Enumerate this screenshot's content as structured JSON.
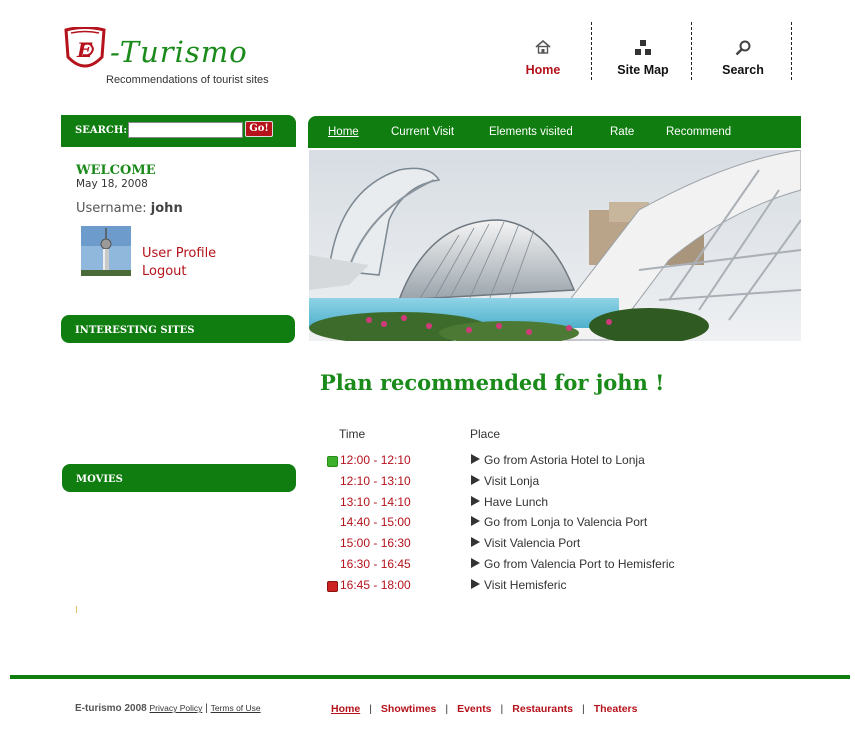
{
  "logo": {
    "brand": "-Turismo",
    "tagline": "Recommendations of tourist sites",
    "shield_letters": "E"
  },
  "topnav": [
    {
      "label": "Home",
      "icon": "house-icon",
      "active": true
    },
    {
      "label": "Site Map",
      "icon": "sitemap-icon"
    },
    {
      "label": "Search",
      "icon": "magnifier-icon"
    }
  ],
  "search": {
    "label": "SEARCH:",
    "value": "",
    "button": "Go!"
  },
  "welcome": {
    "title": "WELCOME",
    "date": "May 18, 2008",
    "username_label": "Username:",
    "username": "john",
    "user_profile": "User Profile",
    "logout": "Logout"
  },
  "sidebar": {
    "sites_header": "INTERESTING SITES",
    "movies_header": "MOVIES"
  },
  "mainnav": [
    "Home",
    "Current Visit",
    "Elements visited",
    "Rate",
    "Recommend"
  ],
  "plan": {
    "title": "Plan recommended for john !",
    "col_time": "Time",
    "col_place": "Place",
    "rows": [
      {
        "time": "12:00 - 12:10",
        "place": "Go from Astoria Hotel to Lonja",
        "marker": "start"
      },
      {
        "time": "12:10 - 13:10",
        "place": "Visit Lonja"
      },
      {
        "time": "13:10 - 14:10",
        "place": "Have Lunch"
      },
      {
        "time": "14:40 - 15:00",
        "place": "Go from Lonja to Valencia Port"
      },
      {
        "time": "15:00 - 16:30",
        "place": "Visit Valencia Port"
      },
      {
        "time": "16:30 - 16:45",
        "place": "Go from Valencia Port to Hemisferic"
      },
      {
        "time": "16:45 - 18:00",
        "place": "Visit Hemisferic",
        "marker": "end"
      }
    ]
  },
  "footer": {
    "copyright": "E-turismo 2008",
    "privacy": "Privacy Policy",
    "terms": "Terms of Use",
    "sep": "|",
    "links": [
      "Home",
      "Showtimes",
      "Events",
      "Restaurants",
      "Theaters"
    ]
  },
  "colors": {
    "green": "#0f7d0f",
    "title_green": "#1a8a1a",
    "red": "#b5121b",
    "start_marker": "#3cb02a",
    "end_marker": "#cc2222"
  }
}
